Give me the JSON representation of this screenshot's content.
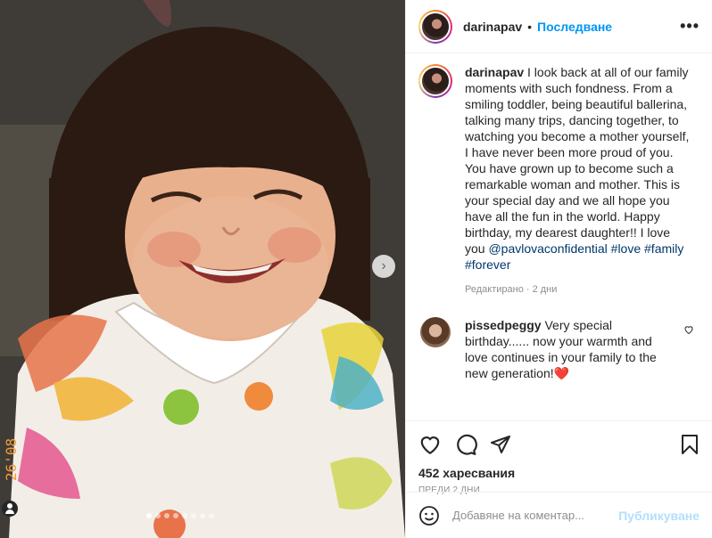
{
  "post": {
    "username": "darinapav",
    "separator": "•",
    "follow_label": "Последване",
    "more_label": "•••",
    "caption_username": "darinapav",
    "caption_text": " I look back at all of our family moments with such fondness. From a smiling toddler, being beautiful ballerina, talking many trips, dancing together, to watching you become a mother yourself, I have never been more proud of you. You have grown up to become such a remarkable woman and mother. This is your special day and we all hope you have all the fun in the world. Happy birthday, my dearest daughter!! I love you ",
    "mention": "@pavlovaconfidential",
    "hashtag_love": "#love",
    "hashtag_family": "#family",
    "hashtag_forever": "#forever",
    "edited_meta": "Редактирано · 2 дни",
    "likes": "452 харесвания",
    "date": "ПРЕДИ 2 ДНИ"
  },
  "comment": {
    "username": "pissedpeggy",
    "text": " Very special birthday...... now your warmth and love continues in your family to the new generation!",
    "emoji": "❤️"
  },
  "add_comment": {
    "placeholder": "Добавяне на коментар...",
    "post_label": "Публикуване"
  },
  "carousel": {
    "slides": 8,
    "active_index": 0,
    "next_icon": "chevron-right-icon"
  },
  "photo_stamp": "26'08",
  "colors": {
    "accent": "#0095f6",
    "link": "#00376b",
    "muted": "#8e8e8e",
    "post_disabled": "#b2dffc"
  }
}
